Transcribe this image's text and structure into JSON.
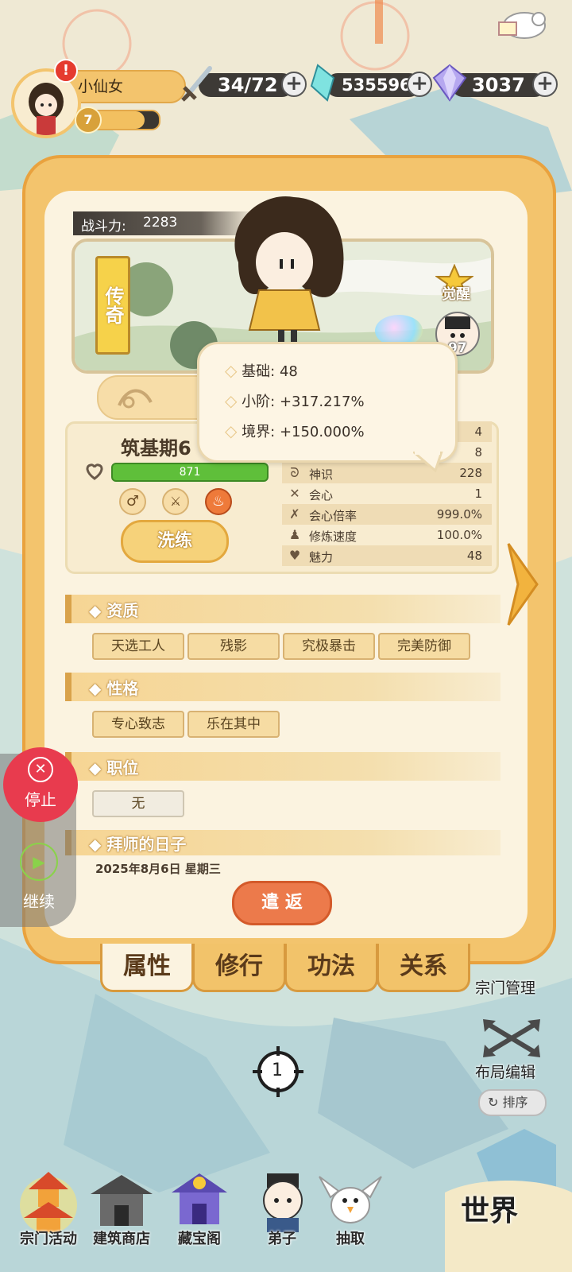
{
  "player": {
    "name": "小仙女",
    "level": "7",
    "alert": "!"
  },
  "currencies": [
    {
      "icon": "sword-icon",
      "value": "34/72"
    },
    {
      "icon": "crystal-icon",
      "value": "535596"
    },
    {
      "icon": "diamond-icon",
      "value": "3037"
    }
  ],
  "disciple": {
    "power_label": "战斗力:",
    "power_value": "2283",
    "rarity": "传奇",
    "awaken": "觉醒",
    "companion_level": "97",
    "realm": "筑基期6",
    "hp": "871",
    "refine_button": "洗练"
  },
  "tooltip": {
    "rows": [
      {
        "label": "基础:",
        "value": "48"
      },
      {
        "label": "小阶:",
        "value": "+317.217%"
      },
      {
        "label": "境界:",
        "value": "+150.000%"
      }
    ]
  },
  "stats": [
    {
      "label": "",
      "value": "4"
    },
    {
      "label": "",
      "value": "8"
    },
    {
      "label": "神识",
      "value": "228"
    },
    {
      "label": "会心",
      "value": "1"
    },
    {
      "label": "会心倍率",
      "value": "999.0%"
    },
    {
      "label": "修炼速度",
      "value": "100.0%"
    },
    {
      "label": "魅力",
      "value": "48"
    }
  ],
  "sections": {
    "aptitude": {
      "title": "◆ 资质",
      "tags": [
        "天选工人",
        "残影",
        "究极暴击",
        "完美防御"
      ]
    },
    "personality": {
      "title": "◆ 性格",
      "tags": [
        "专心致志",
        "乐在其中"
      ]
    },
    "position": {
      "title": "◆ 职位",
      "value": "无"
    },
    "apprentice": {
      "title": "◆ 拜师的日子",
      "date": "2025年8月6日 星期三"
    }
  },
  "dismiss_button": "遣 返",
  "tabs": [
    "属性",
    "修行",
    "功法",
    "关系"
  ],
  "side_controls": {
    "stop": "停止",
    "continue": "继续"
  },
  "right_menu": {
    "sect_manage": "宗门管理",
    "layout_edit": "布局编辑",
    "sort": "排序"
  },
  "locator_number": "1",
  "bottom_nav": [
    "宗门活动",
    "建筑商店",
    "藏宝阁",
    "弟子",
    "抽取"
  ],
  "world_label": "世界",
  "colors": {
    "accent": "#f2c36a",
    "border": "#e9a23e",
    "hp_green": "#5fbf3a",
    "stop_red": "#e83b4e",
    "dismiss": "#ec7a4b"
  }
}
